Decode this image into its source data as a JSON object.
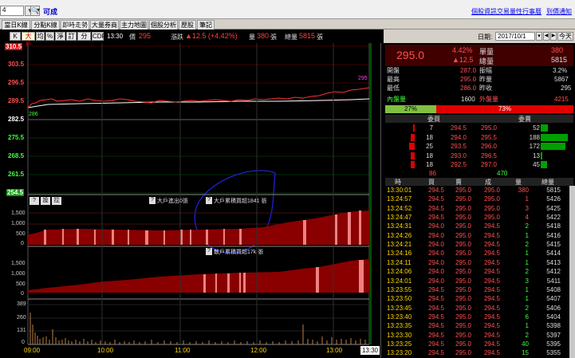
{
  "topbar": {
    "stock_code": "4",
    "stock_name": "可成",
    "links": [
      "個股資訊",
      "交易量性",
      "行事曆",
      "到價通知"
    ]
  },
  "tabs": [
    "當日K線",
    "分點K線",
    "即時走勢",
    "大量券商",
    "主力地圖",
    "個股分析",
    "歷股",
    "筆記"
  ],
  "active_tab": "即時走勢",
  "chart_toolbar": {
    "buttons": [
      "K線",
      "大戶",
      "均",
      "%",
      "淨",
      "訂",
      "分價",
      "CDP"
    ],
    "time": "13:30",
    "price_label": "價",
    "price": "295",
    "change_label": "漲跌",
    "change": "▲12.5 (+4.42%)",
    "vol_label": "量",
    "vol": "380",
    "vol_unit": "張",
    "total_label": "總量",
    "total": "5815",
    "total_unit": "張"
  },
  "price_axis": [
    "310.5",
    "303.5",
    "296.5",
    "289.5",
    "282.5",
    "275.5",
    "268.5",
    "261.5",
    "254.5"
  ],
  "price_markers": {
    "last": "295",
    "open": "286"
  },
  "bigorder_panel": {
    "buttons": [
      "?",
      "設",
      "拉"
    ],
    "inflow_label": "大戶進出0張",
    "cumulative_label": "大戶累積買超1841 張",
    "scattered_label": "散戶累積買超17k 張",
    "axis": [
      "1,500",
      "1,000",
      "500",
      "0"
    ],
    "axis2": [
      "1,500",
      "1,000",
      "500",
      "0"
    ]
  },
  "volume_axis": [
    "389",
    "260",
    "131",
    "0"
  ],
  "time_axis": [
    "09:00",
    "10:00",
    "11:00",
    "12:00",
    "13:00"
  ],
  "time_badge": "13:30",
  "quote_panel": {
    "date_label": "日期:",
    "date": "2017/10/1",
    "today_btn": "今天",
    "price": "295.0",
    "pct": "4.42%",
    "chg": "▲12.5",
    "unit_label": "單量",
    "unit_val": "380",
    "total_label": "總量",
    "total_val": "5815",
    "rows": [
      {
        "l1": "開盤",
        "v1": "287.0",
        "l2": "振幅",
        "v2": "3.2%"
      },
      {
        "l1": "最高",
        "v1": "295.0",
        "l2": "昨量",
        "v2": "5867"
      },
      {
        "l1": "最低",
        "v1": "286.0",
        "l2": "昨收",
        "v2": "295"
      }
    ],
    "inner_label": "內盤量",
    "inner_val": "1600",
    "outer_label": "外盤量",
    "outer_val": "4215",
    "inner_pct": "27%",
    "outer_pct": "73%",
    "buy_header": "委買",
    "sell_header": "委賣",
    "book": [
      {
        "bq": "7",
        "bp": "294.5",
        "sp": "295.0",
        "sq": "52"
      },
      {
        "bq": "18",
        "bp": "294.0",
        "sp": "295.5",
        "sq": "188"
      },
      {
        "bq": "25",
        "bp": "293.5",
        "sp": "296.0",
        "sq": "172"
      },
      {
        "bq": "18",
        "bp": "293.0",
        "sp": "296.5",
        "sq": "13"
      },
      {
        "bq": "18",
        "bp": "292.5",
        "sp": "297.0",
        "sq": "45"
      }
    ],
    "buy_sum": "86",
    "sell_sum": "470",
    "tick_headers": [
      "時",
      "買",
      "賣",
      "成",
      "量",
      "總量"
    ],
    "ticks": [
      {
        "t": "13:30:01",
        "b": "294.5",
        "s": "295.0",
        "p": "295.0",
        "v": "380",
        "tot": "5815"
      },
      {
        "t": "13:24:57",
        "b": "294.5",
        "s": "295.0",
        "p": "295.0",
        "v": "1",
        "tot": "5426"
      },
      {
        "t": "13:24:52",
        "b": "294.5",
        "s": "295.0",
        "p": "295.0",
        "v": "3",
        "tot": "5425"
      },
      {
        "t": "13:24:47",
        "b": "294.5",
        "s": "295.0",
        "p": "295.0",
        "v": "4",
        "tot": "5422"
      },
      {
        "t": "13:24:31",
        "b": "294.0",
        "s": "295.0",
        "p": "294.5",
        "v": "2",
        "tot": "5418"
      },
      {
        "t": "13:24:26",
        "b": "294.0",
        "s": "295.0",
        "p": "294.5",
        "v": "1",
        "tot": "5416"
      },
      {
        "t": "13:24:21",
        "b": "294.0",
        "s": "295.0",
        "p": "294.5",
        "v": "2",
        "tot": "5415"
      },
      {
        "t": "13:24:16",
        "b": "294.0",
        "s": "295.0",
        "p": "294.5",
        "v": "1",
        "tot": "5414"
      },
      {
        "t": "13:24:11",
        "b": "294.0",
        "s": "295.0",
        "p": "294.5",
        "v": "1",
        "tot": "5413"
      },
      {
        "t": "13:24:06",
        "b": "294.0",
        "s": "295.0",
        "p": "294.5",
        "v": "2",
        "tot": "5412"
      },
      {
        "t": "13:24:01",
        "b": "294.0",
        "s": "295.0",
        "p": "294.5",
        "v": "3",
        "tot": "5411"
      },
      {
        "t": "13:23:55",
        "b": "294.5",
        "s": "295.0",
        "p": "294.5",
        "v": "1",
        "tot": "5408"
      },
      {
        "t": "13:23:50",
        "b": "294.5",
        "s": "295.0",
        "p": "294.5",
        "v": "1",
        "tot": "5407"
      },
      {
        "t": "13:23:45",
        "b": "294.5",
        "s": "295.0",
        "p": "294.5",
        "v": "2",
        "tot": "5406"
      },
      {
        "t": "13:23:40",
        "b": "294.5",
        "s": "295.0",
        "p": "294.5",
        "v": "6",
        "tot": "5404"
      },
      {
        "t": "13:23:35",
        "b": "294.5",
        "s": "295.0",
        "p": "294.5",
        "v": "1",
        "tot": "5398"
      },
      {
        "t": "13:23:30",
        "b": "294.5",
        "s": "295.0",
        "p": "294.5",
        "v": "2",
        "tot": "5397"
      },
      {
        "t": "13:23:25",
        "b": "294.5",
        "s": "295.0",
        "p": "294.5",
        "v": "40",
        "tot": "5395"
      },
      {
        "t": "13:23:20",
        "b": "294.5",
        "s": "295.0",
        "p": "294.5",
        "v": "15",
        "tot": "5355"
      }
    ]
  }
}
